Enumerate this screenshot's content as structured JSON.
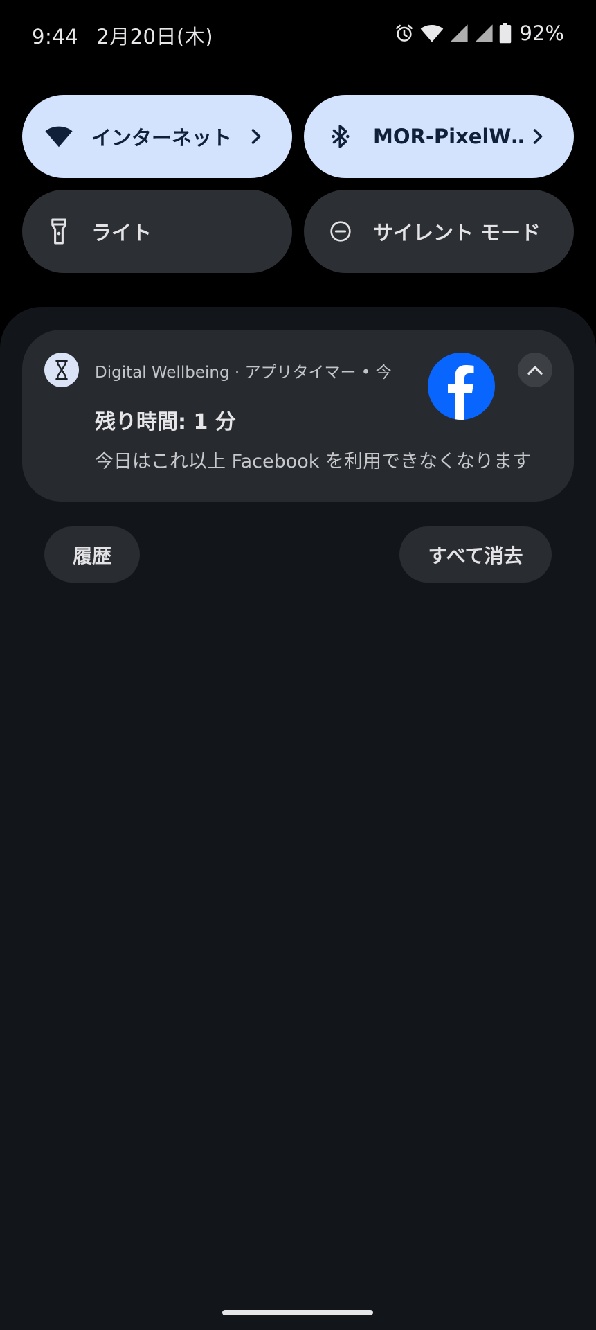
{
  "status_bar": {
    "time": "9:44",
    "date": "2月20日(木)",
    "battery_percent": "92%",
    "icons": [
      "alarm-icon",
      "wifi-icon",
      "signal-icon",
      "signal-icon",
      "battery-icon"
    ]
  },
  "quick_settings": {
    "tiles": [
      {
        "label": "インターネット",
        "icon": "wifi-icon",
        "state": "on",
        "has_chevron": true
      },
      {
        "label": "MOR-PixelW‥",
        "icon": "bluetooth-icon",
        "state": "on",
        "has_chevron": true
      },
      {
        "label": "ライト",
        "icon": "flashlight-icon",
        "state": "off",
        "has_chevron": false
      },
      {
        "label": "サイレント モード",
        "icon": "do-not-disturb-icon",
        "state": "off",
        "has_chevron": false
      }
    ]
  },
  "notification": {
    "app_icon": "hourglass-icon",
    "header": "Digital Wellbeing · アプリタイマー • 今",
    "title": "残り時間: 1 分",
    "body": "今日はこれ以上 Facebook を利用できなくなります",
    "large_icon": "facebook-icon",
    "expand_icon": "chevron-up-icon"
  },
  "actions": {
    "history_label": "履歴",
    "clear_all_label": "すべて消去"
  },
  "colors": {
    "active_tile": "#d3e3fd",
    "inactive_tile": "#2c2f33",
    "shade_background": "#121519",
    "notification_card": "#272a2e",
    "facebook_blue": "#0866ff"
  }
}
